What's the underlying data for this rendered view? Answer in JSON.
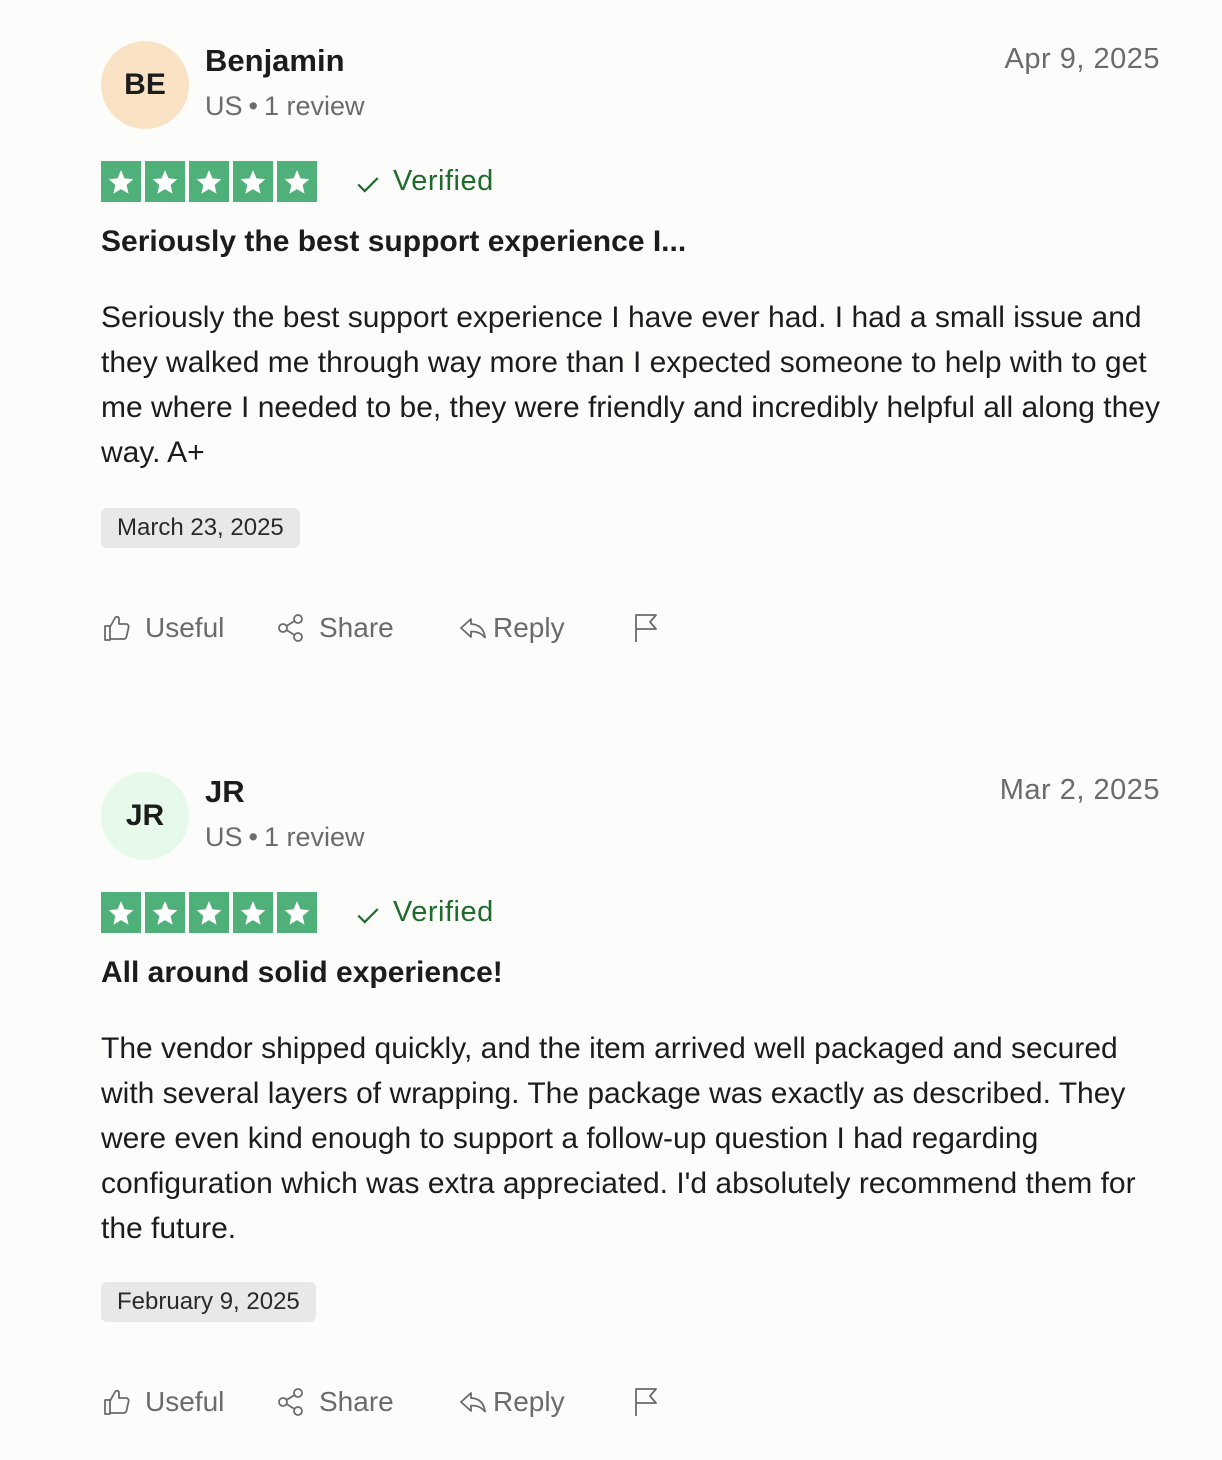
{
  "colors": {
    "star_green": "#4fb07a",
    "verified_green": "#1e6b2c",
    "avatar_be": "#f9e3c4",
    "avatar_jr": "#e5faea"
  },
  "reviews": [
    {
      "initials": "BE",
      "name": "Benjamin",
      "country": "US",
      "review_count": "1 review",
      "date": "Apr 9, 2025",
      "rating": 5,
      "verified_label": "Verified",
      "title": "Seriously the best support experience I...",
      "body": "Seriously the best support experience I have ever had. I had a small issue and they walked me through way more than I expected someone to help with to get me where I needed to be, they were friendly and incredibly helpful all along they way. A+",
      "experience_date": "March 23, 2025",
      "actions": {
        "useful": "Useful",
        "share": "Share",
        "reply": "Reply"
      }
    },
    {
      "initials": "JR",
      "name": "JR",
      "country": "US",
      "review_count": "1 review",
      "date": "Mar 2, 2025",
      "rating": 5,
      "verified_label": "Verified",
      "title": "All around solid experience!",
      "body": "The vendor shipped quickly, and the item arrived well packaged and secured with several layers of wrapping. The package was exactly as described. They were even kind enough to support a follow-up question I had regarding configuration which was extra appreciated. I'd absolutely recommend them for the future.",
      "experience_date": "February 9, 2025",
      "actions": {
        "useful": "Useful",
        "share": "Share",
        "reply": "Reply"
      }
    }
  ],
  "icons": [
    "thumbs-up-icon",
    "share-icon",
    "reply-icon",
    "flag-icon",
    "star-icon",
    "check-icon"
  ]
}
